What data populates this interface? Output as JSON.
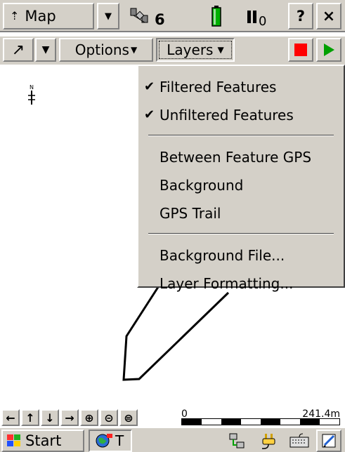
{
  "topbar": {
    "map_label": "Map",
    "satellite_count": "6",
    "signal_count": "0",
    "help_label": "?",
    "close_label": "×"
  },
  "toolbar": {
    "tool_glyph": "↗",
    "options_label": "Options",
    "layers_label": "Layers"
  },
  "layers_menu": {
    "items": [
      {
        "label": "Filtered Features",
        "checked": true
      },
      {
        "label": "Unfiltered Features",
        "checked": true
      },
      {
        "label": "Between Feature GPS",
        "checked": false
      },
      {
        "label": "Background",
        "checked": false
      },
      {
        "label": "GPS Trail",
        "checked": false
      },
      {
        "label": "Background File...",
        "checked": false
      },
      {
        "label": "Layer Formatting...",
        "checked": false
      }
    ],
    "check_glyph": "✔"
  },
  "navbar": {
    "buttons": [
      "←",
      "↑",
      "↓",
      "→",
      "⊕",
      "⊝",
      "⊜"
    ],
    "scale_zero": "0",
    "scale_value": "241.4m"
  },
  "taskbar": {
    "start_label": "Start",
    "task_label": "T"
  },
  "colors": {
    "chrome": "#d4d0c8",
    "stop_red": "#ff0000",
    "play_green": "#00a000",
    "battery_green": "#00b000"
  },
  "icons": {
    "north_arrow": "north-arrow-icon",
    "satellite": "satellite-icon",
    "battery": "battery-icon",
    "signal": "signal-icon",
    "windows_flag": "windows-flag-icon",
    "globe": "globe-icon",
    "connectivity": "connectivity-icon",
    "power": "power-plug-icon",
    "keyboard": "keyboard-icon",
    "notes": "notes-icon"
  }
}
